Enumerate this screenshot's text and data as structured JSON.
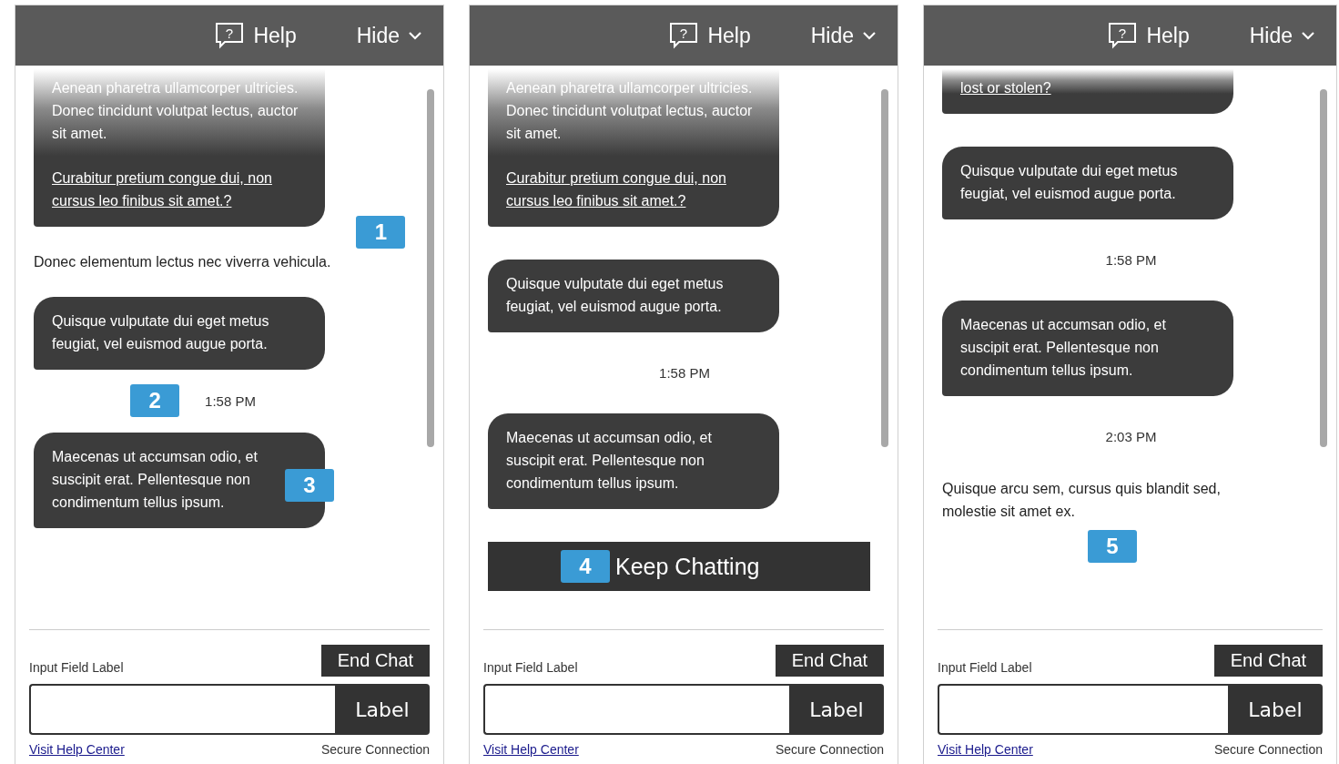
{
  "panels": [
    {
      "header": {
        "icon_glyph": "?",
        "help": "Help",
        "hide": "Hide"
      },
      "messages": [
        {
          "kind": "bubble",
          "faded": true,
          "text": "Aenean pharetra ullamcorper ultricies. Donec tincidunt volutpat lectus, auctor sit amet.",
          "link": "Curabitur pretium congue dui, non cursus leo finibus sit amet.?"
        },
        {
          "kind": "plain",
          "text": "Donec elementum lectus nec viverra vehicula.",
          "badge": "1"
        },
        {
          "kind": "bubble",
          "faded": false,
          "text": "Quisque vulputate dui eget metus feugiat, vel euismod augue porta."
        },
        {
          "kind": "time",
          "text": "1:58 PM",
          "badge": "2"
        },
        {
          "kind": "bubble",
          "faded": false,
          "text": "Maecenas ut accumsan odio, et suscipit erat. Pellentesque non condimentum tellus ipsum.",
          "badge": "3"
        }
      ],
      "footer": {
        "input_label": "Input Field Label",
        "end_chat": "End Chat",
        "send": "Label",
        "help_link": "Visit Help Center",
        "secure": "Secure Connection"
      }
    },
    {
      "header": {
        "icon_glyph": "?",
        "help": "Help",
        "hide": "Hide"
      },
      "messages": [
        {
          "kind": "bubble",
          "faded": true,
          "text": "Aenean pharetra ullamcorper ultricies. Donec tincidunt volutpat lectus, auctor sit amet.",
          "link": "Curabitur pretium congue dui, non cursus leo finibus sit amet.?"
        },
        {
          "kind": "bubble",
          "faded": false,
          "text": "Quisque vulputate dui eget metus feugiat, vel euismod augue porta."
        },
        {
          "kind": "time",
          "text": "1:58 PM"
        },
        {
          "kind": "bubble",
          "faded": false,
          "text": "Maecenas ut accumsan odio, et suscipit erat. Pellentesque non condimentum tellus ipsum."
        },
        {
          "kind": "button",
          "text": "Keep Chatting",
          "badge": "4"
        }
      ],
      "footer": {
        "input_label": "Input Field Label",
        "end_chat": "End Chat",
        "send": "Label",
        "help_link": "Visit Help Center",
        "secure": "Secure Connection"
      }
    },
    {
      "header": {
        "icon_glyph": "?",
        "help": "Help",
        "hide": "Hide"
      },
      "messages": [
        {
          "kind": "bubble",
          "faded": true,
          "link": "lost or stolen?"
        },
        {
          "kind": "bubble",
          "faded": false,
          "text": "Quisque vulputate dui eget metus feugiat, vel euismod augue porta."
        },
        {
          "kind": "time",
          "text": "1:58 PM"
        },
        {
          "kind": "bubble",
          "faded": false,
          "text": "Maecenas ut accumsan odio, et suscipit erat. Pellentesque non condimentum tellus ipsum."
        },
        {
          "kind": "time",
          "text": "2:03 PM"
        },
        {
          "kind": "plain",
          "text": "Quisque arcu sem, cursus quis blandit sed, molestie sit amet ex.",
          "badge": "5"
        }
      ],
      "footer": {
        "input_label": "Input Field Label",
        "end_chat": "End Chat",
        "send": "Label",
        "help_link": "Visit Help Center",
        "secure": "Secure Connection"
      }
    }
  ]
}
